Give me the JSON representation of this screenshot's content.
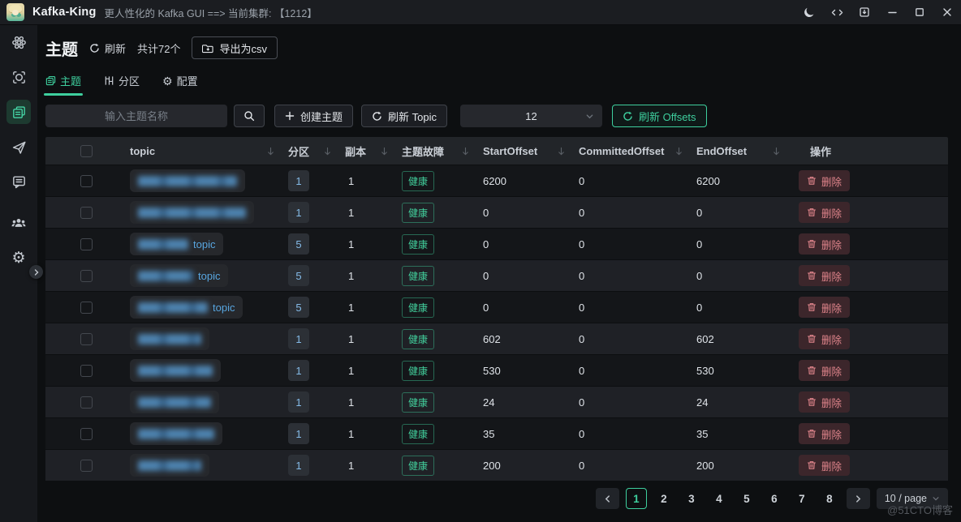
{
  "titlebar": {
    "app_name": "Kafka-King",
    "subtitle": "更人性化的 Kafka GUI ==> 当前集群: 【1212】",
    "controls": [
      "theme-toggle",
      "devtools",
      "install",
      "minimize",
      "maximize",
      "close"
    ]
  },
  "sidebar": {
    "items": [
      {
        "icon": "cluster-icon",
        "active": false
      },
      {
        "icon": "monitor-icon",
        "active": false
      },
      {
        "icon": "topics-icon",
        "active": true
      },
      {
        "icon": "producer-send-icon",
        "active": false
      },
      {
        "icon": "consumer-message-icon",
        "active": false
      },
      {
        "icon": "consumer-group-icon",
        "active": false
      },
      {
        "icon": "settings-gear-icon",
        "active": false
      }
    ]
  },
  "page": {
    "title": "主题",
    "refresh_label": "刷新",
    "count_label": "共计72个",
    "export_label": "导出为csv"
  },
  "tabs": [
    {
      "label": "主题",
      "icon": "topics-icon",
      "active": true
    },
    {
      "label": "分区",
      "icon": "partition-icon",
      "active": false
    },
    {
      "label": "配置",
      "icon": "config-gear-icon",
      "active": false
    }
  ],
  "toolbar": {
    "search_placeholder": "输入主题名称",
    "create_label": "创建主题",
    "refresh_topic_label": "刷新 Topic",
    "page_size_value": "12",
    "refresh_offsets_label": "刷新 Offsets"
  },
  "table": {
    "columns": [
      {
        "label": "topic",
        "sortable": true
      },
      {
        "label": "分区",
        "sortable": true
      },
      {
        "label": "副本",
        "sortable": true
      },
      {
        "label": "主题故障",
        "sortable": true
      },
      {
        "label": "StartOffset",
        "sortable": true
      },
      {
        "label": "CommittedOffset",
        "sortable": true
      },
      {
        "label": "EndOffset",
        "sortable": true
      },
      {
        "label": "操作",
        "sortable": false
      }
    ],
    "delete_label": "删除",
    "rows": [
      {
        "topic_suffix": "",
        "redacted_width": 122,
        "partitions": "1",
        "replicas": "1",
        "health": "健康",
        "start_offset": "6200",
        "committed_offset": "0",
        "end_offset": "6200"
      },
      {
        "topic_suffix": "",
        "redacted_width": 133,
        "partitions": "1",
        "replicas": "1",
        "health": "健康",
        "start_offset": "0",
        "committed_offset": "0",
        "end_offset": "0"
      },
      {
        "topic_suffix": "topic",
        "redacted_width": 62,
        "partitions": "5",
        "replicas": "1",
        "health": "健康",
        "start_offset": "0",
        "committed_offset": "0",
        "end_offset": "0"
      },
      {
        "topic_suffix": "topic",
        "redacted_width": 68,
        "partitions": "5",
        "replicas": "1",
        "health": "健康",
        "start_offset": "0",
        "committed_offset": "0",
        "end_offset": "0"
      },
      {
        "topic_suffix": "topic",
        "redacted_width": 86,
        "partitions": "5",
        "replicas": "1",
        "health": "健康",
        "start_offset": "0",
        "committed_offset": "0",
        "end_offset": "0"
      },
      {
        "topic_suffix": "",
        "redacted_width": 78,
        "partitions": "1",
        "replicas": "1",
        "health": "健康",
        "start_offset": "602",
        "committed_offset": "0",
        "end_offset": "602"
      },
      {
        "topic_suffix": "",
        "redacted_width": 92,
        "partitions": "1",
        "replicas": "1",
        "health": "健康",
        "start_offset": "530",
        "committed_offset": "0",
        "end_offset": "530"
      },
      {
        "topic_suffix": "",
        "redacted_width": 90,
        "partitions": "1",
        "replicas": "1",
        "health": "健康",
        "start_offset": "24",
        "committed_offset": "0",
        "end_offset": "24"
      },
      {
        "topic_suffix": "",
        "redacted_width": 94,
        "partitions": "1",
        "replicas": "1",
        "health": "健康",
        "start_offset": "35",
        "committed_offset": "0",
        "end_offset": "35"
      },
      {
        "topic_suffix": "",
        "redacted_width": 78,
        "partitions": "1",
        "replicas": "1",
        "health": "健康",
        "start_offset": "200",
        "committed_offset": "0",
        "end_offset": "200"
      }
    ]
  },
  "pagination": {
    "pages": [
      "1",
      "2",
      "3",
      "4",
      "5",
      "6",
      "7",
      "8"
    ],
    "active_page": "1",
    "page_size_label": "10 / page"
  },
  "colors": {
    "accent_teal": "#3ecf9e",
    "danger_red": "#e1858c",
    "link_blue": "#58a6e0",
    "partition_blue": "#85bbe8"
  },
  "watermark": "@51CTO博客"
}
